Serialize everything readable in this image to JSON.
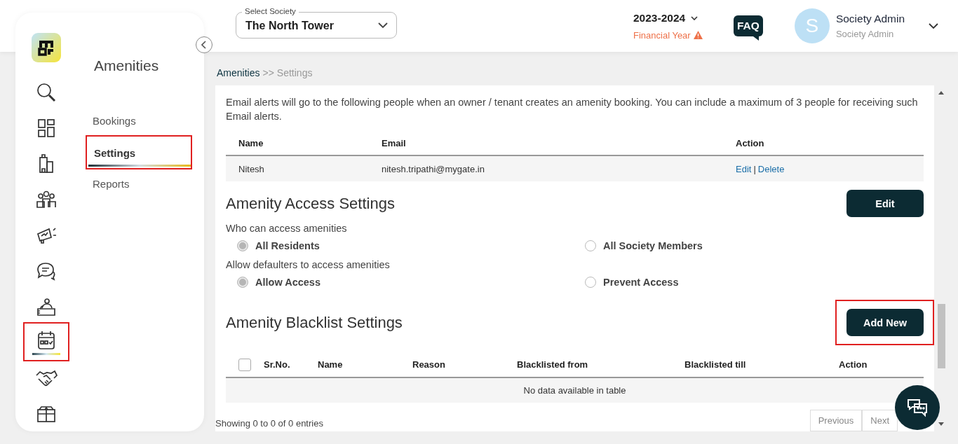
{
  "header": {
    "society_select": {
      "label": "Select Society",
      "value": "The North Tower"
    },
    "financial_year": {
      "value": "2023-2024",
      "label": "Financial Year"
    },
    "faq": "FAQ",
    "user": {
      "initial": "S",
      "name": "Society Admin",
      "role": "Society Admin"
    }
  },
  "icon_rail": [
    {
      "kind": "search",
      "selected": false,
      "highlighted": false
    },
    {
      "kind": "grid",
      "selected": false,
      "highlighted": false
    },
    {
      "kind": "building",
      "selected": false,
      "highlighted": false
    },
    {
      "kind": "people",
      "selected": false,
      "highlighted": false
    },
    {
      "kind": "megaphone",
      "selected": false,
      "highlighted": false
    },
    {
      "kind": "chat",
      "selected": false,
      "highlighted": false
    },
    {
      "kind": "reception",
      "selected": false,
      "highlighted": false
    },
    {
      "kind": "calendar",
      "selected": true,
      "highlighted": true
    },
    {
      "kind": "handshake",
      "selected": false,
      "highlighted": false
    },
    {
      "kind": "box",
      "selected": false,
      "highlighted": false
    }
  ],
  "submenu": {
    "title": "Amenities",
    "items": [
      {
        "label": "Bookings",
        "selected": false,
        "highlighted": false
      },
      {
        "label": "Settings",
        "selected": true,
        "highlighted": true
      },
      {
        "label": "Reports",
        "selected": false,
        "highlighted": false
      }
    ]
  },
  "breadcrumb": {
    "parent": "Amenities",
    "separator": ">>",
    "current": "Settings"
  },
  "email_alerts": {
    "description": "Email alerts will go to the following people when an owner / tenant creates an amenity booking. You can include a maximum of 3 people for receiving such Email alerts.",
    "columns": [
      "Name",
      "Email",
      "Action"
    ],
    "rows": [
      {
        "name": "Nitesh",
        "email": "nitesh.tripathi@mygate.in",
        "actions": [
          "Edit",
          "Delete"
        ],
        "separator": "|"
      }
    ]
  },
  "access_settings": {
    "title": "Amenity Access Settings",
    "button": "Edit",
    "groups": [
      {
        "question": "Who can access amenities",
        "options": [
          {
            "label": "All Residents",
            "selected": true
          },
          {
            "label": "All Society Members",
            "selected": false
          }
        ]
      },
      {
        "question": "Allow defaulters to access amenities",
        "options": [
          {
            "label": "Allow Access",
            "selected": true
          },
          {
            "label": "Prevent Access",
            "selected": false
          }
        ]
      }
    ]
  },
  "blacklist": {
    "title": "Amenity Blacklist Settings",
    "button": {
      "label": "Add New",
      "highlighted": true
    },
    "select_all_checked": false,
    "columns": [
      "Sr.No.",
      "Name",
      "Reason",
      "Blacklisted from",
      "Blacklisted till",
      "Action"
    ],
    "empty_message": "No data available in table",
    "footer": "Showing 0 to 0 of 0 entries",
    "pagination": [
      "Previous",
      "Next"
    ]
  }
}
